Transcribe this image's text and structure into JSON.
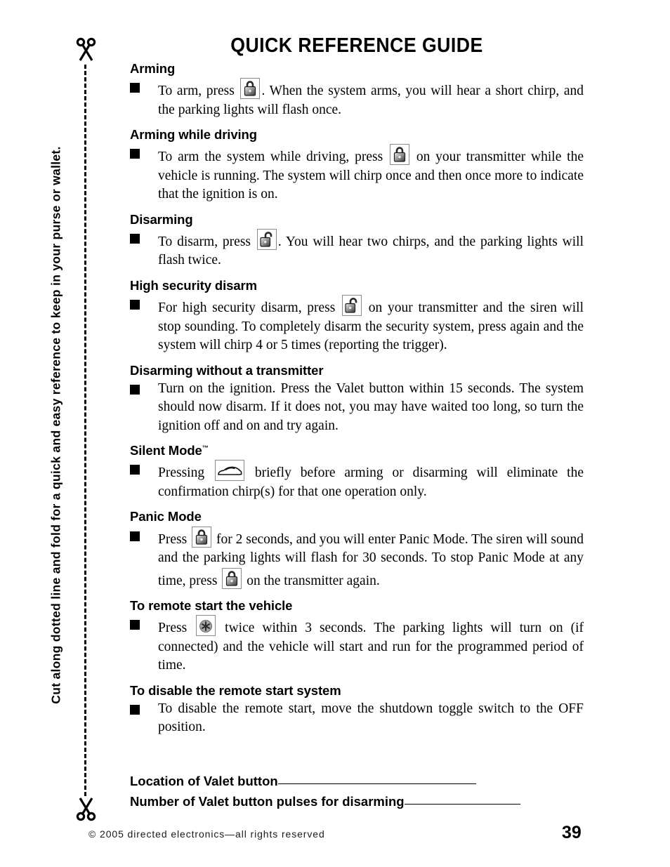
{
  "page": {
    "title": "QUICK REFERENCE GUIDE",
    "number": "39",
    "copyright": "© 2005 directed electronics—all rights reserved"
  },
  "cut_margin": {
    "instruction": "Cut along dotted line and fold for a quick and easy reference to keep in your purse or wallet.",
    "scissors_top_icon": "scissors-icon",
    "scissors_bottom_icon": "scissors-icon",
    "cut_line_style": "dashed"
  },
  "icons": {
    "lock": "lock-closed-icon",
    "unlock": "lock-open-icon",
    "car": "car-icon",
    "star": "asterisk-star-icon"
  },
  "sections": [
    {
      "heading": "Arming",
      "tm": false,
      "parts": [
        {
          "type": "text",
          "value": "To arm, press "
        },
        {
          "type": "icon",
          "value": "lock"
        },
        {
          "type": "text",
          "value": ". When the system arms, you will hear a short chirp, and the parking lights will flash once."
        }
      ]
    },
    {
      "heading": "Arming while driving",
      "tm": false,
      "parts": [
        {
          "type": "text",
          "value": "To arm the system while driving, press "
        },
        {
          "type": "icon",
          "value": "lock"
        },
        {
          "type": "text",
          "value": " on your transmitter while the vehicle is running. The system will chirp once and then once more to indicate that the ignition is on."
        }
      ]
    },
    {
      "heading": "Disarming",
      "tm": false,
      "parts": [
        {
          "type": "text",
          "value": "To disarm, press "
        },
        {
          "type": "icon",
          "value": "unlock"
        },
        {
          "type": "text",
          "value": ". You will hear two chirps, and the parking lights will flash twice."
        }
      ]
    },
    {
      "heading": "High security disarm",
      "tm": false,
      "parts": [
        {
          "type": "text",
          "value": "For high security disarm, press "
        },
        {
          "type": "icon",
          "value": "unlock"
        },
        {
          "type": "text",
          "value": " on your transmitter and the siren will stop sounding. To completely disarm the security system, press again and the system will chirp 4 or 5 times (reporting the trigger)."
        }
      ]
    },
    {
      "heading": "Disarming without a transmitter",
      "tm": false,
      "parts": [
        {
          "type": "text",
          "value": "Turn on the ignition. Press the Valet button within 15 seconds. The system should now disarm. If it does not, you may have waited too long, so turn the ignition off and on and try again."
        }
      ]
    },
    {
      "heading": "Silent Mode",
      "tm": true,
      "parts": [
        {
          "type": "text",
          "value": "Pressing "
        },
        {
          "type": "icon",
          "value": "car"
        },
        {
          "type": "text",
          "value": " briefly before arming or disarming will eliminate the confirmation chirp(s) for that one operation only."
        }
      ]
    },
    {
      "heading": "Panic Mode",
      "tm": false,
      "parts": [
        {
          "type": "text",
          "value": "Press "
        },
        {
          "type": "icon",
          "value": "lock"
        },
        {
          "type": "text",
          "value": " for 2 seconds, and you will enter Panic Mode. The siren will sound and the parking lights will flash for 30 seconds. To stop Panic Mode at any time, press "
        },
        {
          "type": "icon",
          "value": "lock"
        },
        {
          "type": "text",
          "value": " on the transmitter again."
        }
      ]
    },
    {
      "heading": "To remote start the vehicle",
      "tm": false,
      "parts": [
        {
          "type": "text",
          "value": "Press "
        },
        {
          "type": "icon",
          "value": "star"
        },
        {
          "type": "text",
          "value": " twice within 3 seconds. The parking lights will turn on (if connected) and the vehicle will start and run for the programmed period of time."
        }
      ]
    },
    {
      "heading": "To disable the remote start system",
      "tm": false,
      "parts": [
        {
          "type": "text",
          "value": "To disable the remote start, move the shutdown toggle switch to the OFF position."
        }
      ]
    }
  ],
  "valet_fields": [
    {
      "label": "Location of Valet button",
      "value": ""
    },
    {
      "label": "Number of Valet button pulses for disarming",
      "value": ""
    }
  ]
}
